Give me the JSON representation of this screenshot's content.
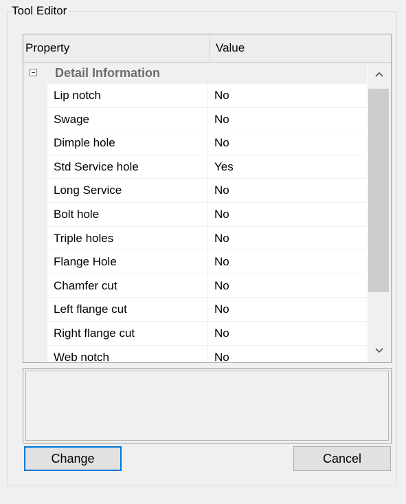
{
  "group": {
    "title": "Tool Editor"
  },
  "grid": {
    "columns": {
      "property": "Property",
      "value": "Value"
    },
    "category": {
      "label": "Detail Information",
      "expanded": true
    },
    "rows": [
      {
        "name": "Lip notch",
        "value": "No"
      },
      {
        "name": "Swage",
        "value": "No"
      },
      {
        "name": "Dimple hole",
        "value": "No"
      },
      {
        "name": "Std Service hole",
        "value": "Yes"
      },
      {
        "name": "Long Service",
        "value": "No"
      },
      {
        "name": "Bolt hole",
        "value": "No"
      },
      {
        "name": "Triple holes",
        "value": "No"
      },
      {
        "name": "Flange Hole",
        "value": "No"
      },
      {
        "name": "Chamfer cut",
        "value": "No"
      },
      {
        "name": "Left flange cut",
        "value": "No"
      },
      {
        "name": "Right flange cut",
        "value": "No"
      },
      {
        "name": "Web notch",
        "value": "No"
      }
    ]
  },
  "description": {
    "text": ""
  },
  "buttons": {
    "change": "Change",
    "cancel": "Cancel"
  },
  "colors": {
    "window_bg": "#f0f0f0",
    "grid_bg": "#ffffff",
    "focus_border": "#0078d7",
    "category_text": "#6d6d6d"
  },
  "icons": {
    "expander": "collapse-minus-icon",
    "scroll_up": "chevron-up-icon",
    "scroll_down": "chevron-down-icon"
  }
}
